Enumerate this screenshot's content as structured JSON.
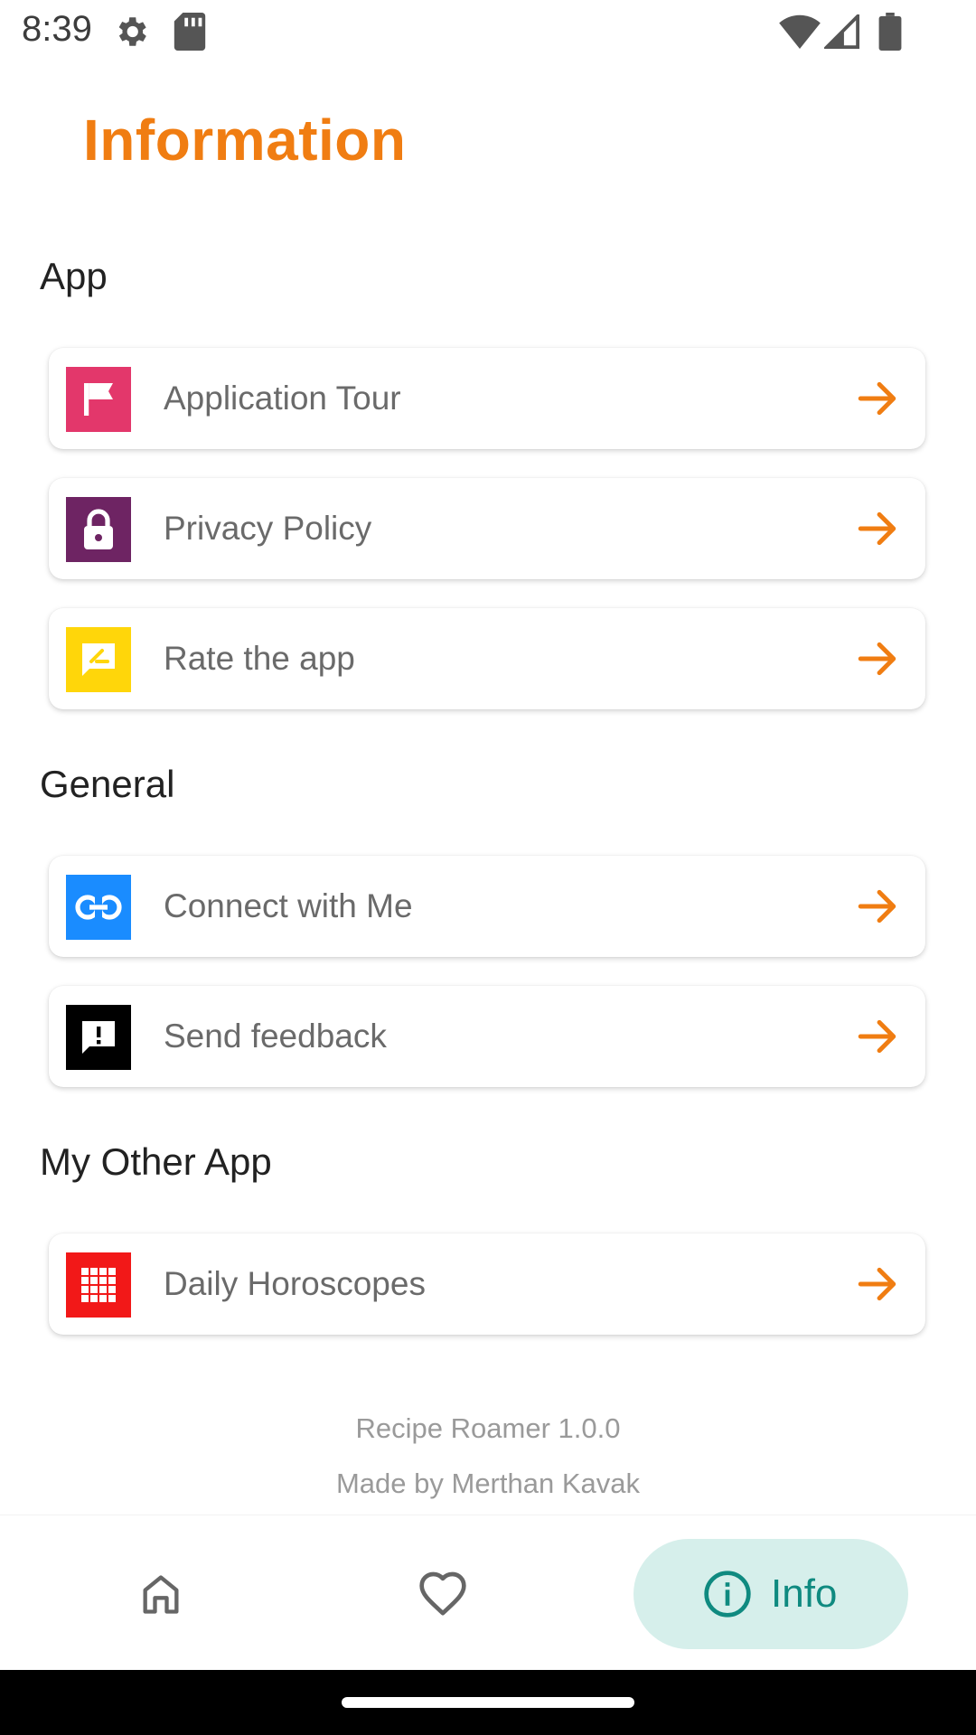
{
  "status_bar": {
    "time": "8:39"
  },
  "page": {
    "title": "Information"
  },
  "sections": [
    {
      "header": "App",
      "items": [
        {
          "label": "Application Tour",
          "icon": "flag-icon",
          "color": "#e3376b"
        },
        {
          "label": "Privacy Policy",
          "icon": "lock-icon",
          "color": "#6e2463"
        },
        {
          "label": "Rate the app",
          "icon": "rate-review-icon",
          "color": "#ffd60a"
        }
      ]
    },
    {
      "header": "General",
      "items": [
        {
          "label": "Connect with Me",
          "icon": "link-icon",
          "color": "#1a8cff"
        },
        {
          "label": "Send feedback",
          "icon": "feedback-icon",
          "color": "#000000"
        }
      ]
    },
    {
      "header": "My Other App",
      "items": [
        {
          "label": "Daily Horoscopes",
          "icon": "app-grid-icon",
          "color": "#f21818"
        }
      ]
    }
  ],
  "footer": {
    "version": "Recipe Roamer 1.0.0",
    "author": "Made by Merthan Kavak"
  },
  "bottom_nav": {
    "info_label": "Info",
    "active": "info"
  },
  "colors": {
    "accent": "#f07d12",
    "nav_active_bg": "#d6efeb",
    "nav_active_fg": "#0f8a80"
  }
}
